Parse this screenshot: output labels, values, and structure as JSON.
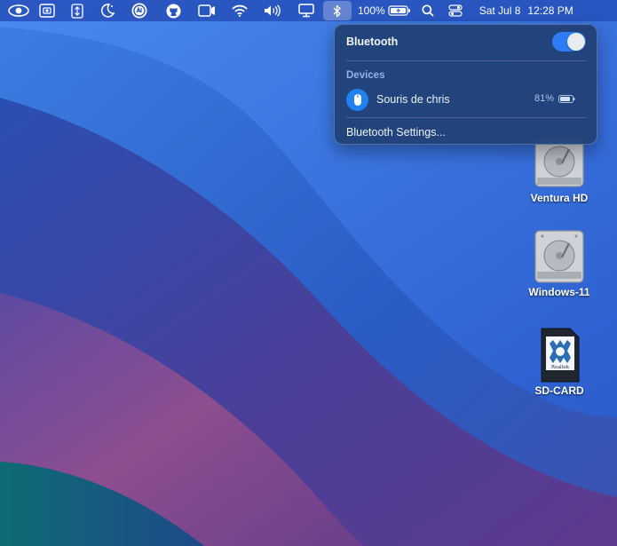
{
  "menubar": {
    "battery_percent": "100%",
    "date": "Sat Jul 8",
    "time": "12:28 PM",
    "icons": [
      "eye-icon",
      "screenshot-icon",
      "transfer-icon",
      "moon-icon",
      "keyboard-layout-icon",
      "github-icon",
      "screen-record-icon",
      "wifi-icon",
      "volume-icon",
      "display-icon",
      "bluetooth-icon",
      "battery-icon",
      "search-icon",
      "control-center-icon"
    ]
  },
  "bluetooth_panel": {
    "title": "Bluetooth",
    "enabled": true,
    "devices_label": "Devices",
    "devices": [
      {
        "name": "Souris de chris",
        "battery": "81%",
        "icon": "mouse-icon"
      }
    ],
    "settings_label": "Bluetooth Settings..."
  },
  "desktop_icons": [
    {
      "label": "Ventura HD",
      "icon": "hard-drive-icon"
    },
    {
      "label": "Windows-11",
      "icon": "hard-drive-icon"
    },
    {
      "label": "SD-CARD",
      "icon": "sd-card-icon",
      "brand": "Realtek"
    }
  ],
  "colors": {
    "menubar": "#2852be",
    "accent": "#2f7df6",
    "panel": "#214278"
  }
}
